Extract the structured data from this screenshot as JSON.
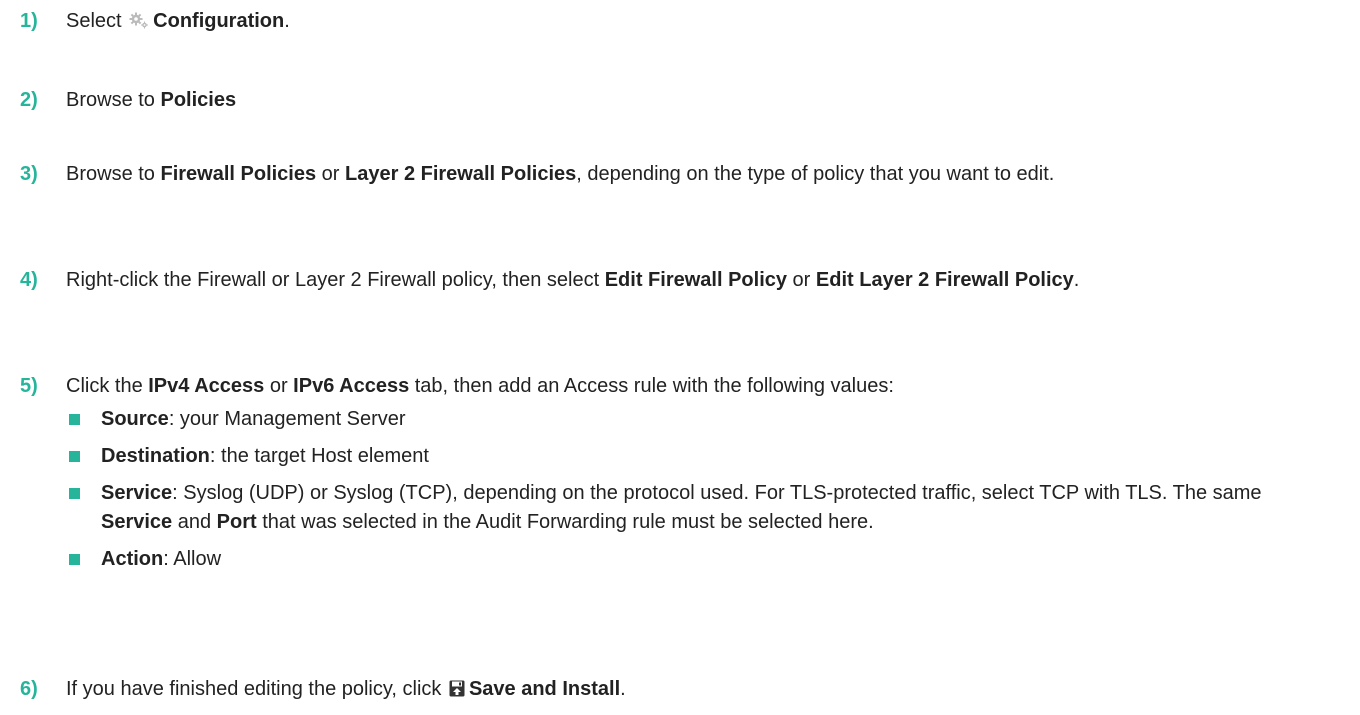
{
  "steps": [
    {
      "number": "1)",
      "parts": [
        {
          "t": "Select "
        },
        {
          "icon": "gear-icon"
        },
        {
          "t": "Configuration",
          "b": true
        },
        {
          "t": "."
        }
      ]
    },
    {
      "number": "2)",
      "parts": [
        {
          "t": "Browse to "
        },
        {
          "t": "Policies",
          "b": true
        }
      ]
    },
    {
      "number": "3)",
      "parts": [
        {
          "t": "Browse to "
        },
        {
          "t": "Firewall Policies",
          "b": true
        },
        {
          "t": " or "
        },
        {
          "t": "Layer 2 Firewall Policies",
          "b": true
        },
        {
          "t": ", depending on the type of policy that you want to edit."
        }
      ]
    },
    {
      "number": "4)",
      "parts": [
        {
          "t": "Right-click the Firewall or Layer 2 Firewall policy, then select "
        },
        {
          "t": "Edit Firewall Policy",
          "b": true
        },
        {
          "t": " or "
        },
        {
          "t": "Edit Layer 2 Firewall Policy",
          "b": true
        },
        {
          "t": "."
        }
      ]
    },
    {
      "number": "5)",
      "parts": [
        {
          "t": "Click the "
        },
        {
          "t": "IPv4 Access",
          "b": true
        },
        {
          "t": " or "
        },
        {
          "t": "IPv6 Access",
          "b": true
        },
        {
          "t": " tab, then add an Access rule with the following values:"
        }
      ],
      "subitems": [
        [
          {
            "t": "Source",
            "b": true
          },
          {
            "t": ": your Management Server"
          }
        ],
        [
          {
            "t": "Destination",
            "b": true
          },
          {
            "t": ": the target Host element"
          }
        ],
        [
          {
            "t": "Service",
            "b": true
          },
          {
            "t": ": Syslog (UDP) or Syslog (TCP), depending on the protocol used. For TLS-protected traffic, select TCP with TLS. The same "
          },
          {
            "t": "Service",
            "b": true
          },
          {
            "t": " and "
          },
          {
            "t": "Port",
            "b": true
          },
          {
            "t": " that was selected in the Audit Forwarding rule must be selected here."
          }
        ],
        [
          {
            "t": "Action",
            "b": true
          },
          {
            "t": ": Allow"
          }
        ]
      ]
    },
    {
      "number": "6)",
      "parts": [
        {
          "t": "If you have finished editing the policy, click "
        },
        {
          "icon": "save-install-icon"
        },
        {
          "t": "Save and Install",
          "b": true
        },
        {
          "t": "."
        }
      ]
    }
  ],
  "colors": {
    "accent": "#26b59a",
    "text": "#222222",
    "icon": "#bbbbbb"
  }
}
